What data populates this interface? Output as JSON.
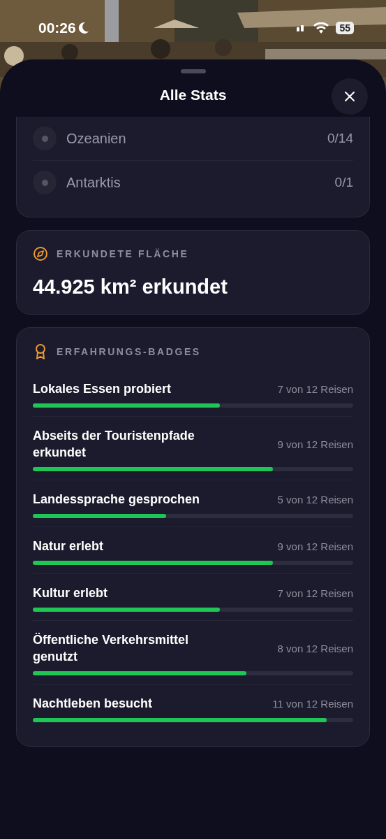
{
  "status_bar": {
    "time": "00:26",
    "battery": "55"
  },
  "sheet": {
    "title": "Alle Stats"
  },
  "continents": [
    {
      "name": "Ozeanien",
      "count": "0/14"
    },
    {
      "name": "Antarktis",
      "count": "0/1"
    }
  ],
  "area": {
    "heading": "ERKUNDETE FLÄCHE",
    "value": "44.925 km² erkundet"
  },
  "badges": {
    "heading": "ERFAHRUNGS-BADGES",
    "items": [
      {
        "name": "Lokales Essen probiert",
        "count": "7 von 12 Reisen",
        "level": 0.583
      },
      {
        "name": "Abseits der Touristenpfade erkundet",
        "count": "9 von 12 Reisen",
        "level": 0.75
      },
      {
        "name": "Landessprache gesprochen",
        "count": "5 von 12 Reisen",
        "level": 0.417
      },
      {
        "name": "Natur erlebt",
        "count": "9 von 12 Reisen",
        "level": 0.75
      },
      {
        "name": "Kultur erlebt",
        "count": "7 von 12 Reisen",
        "level": 0.583
      },
      {
        "name": "Öffentliche Verkehrsmittel genutzt",
        "count": "8 von 12 Reisen",
        "level": 0.667
      },
      {
        "name": "Nachtleben besucht",
        "count": "11 von 12 Reisen",
        "level": 0.917
      }
    ]
  }
}
